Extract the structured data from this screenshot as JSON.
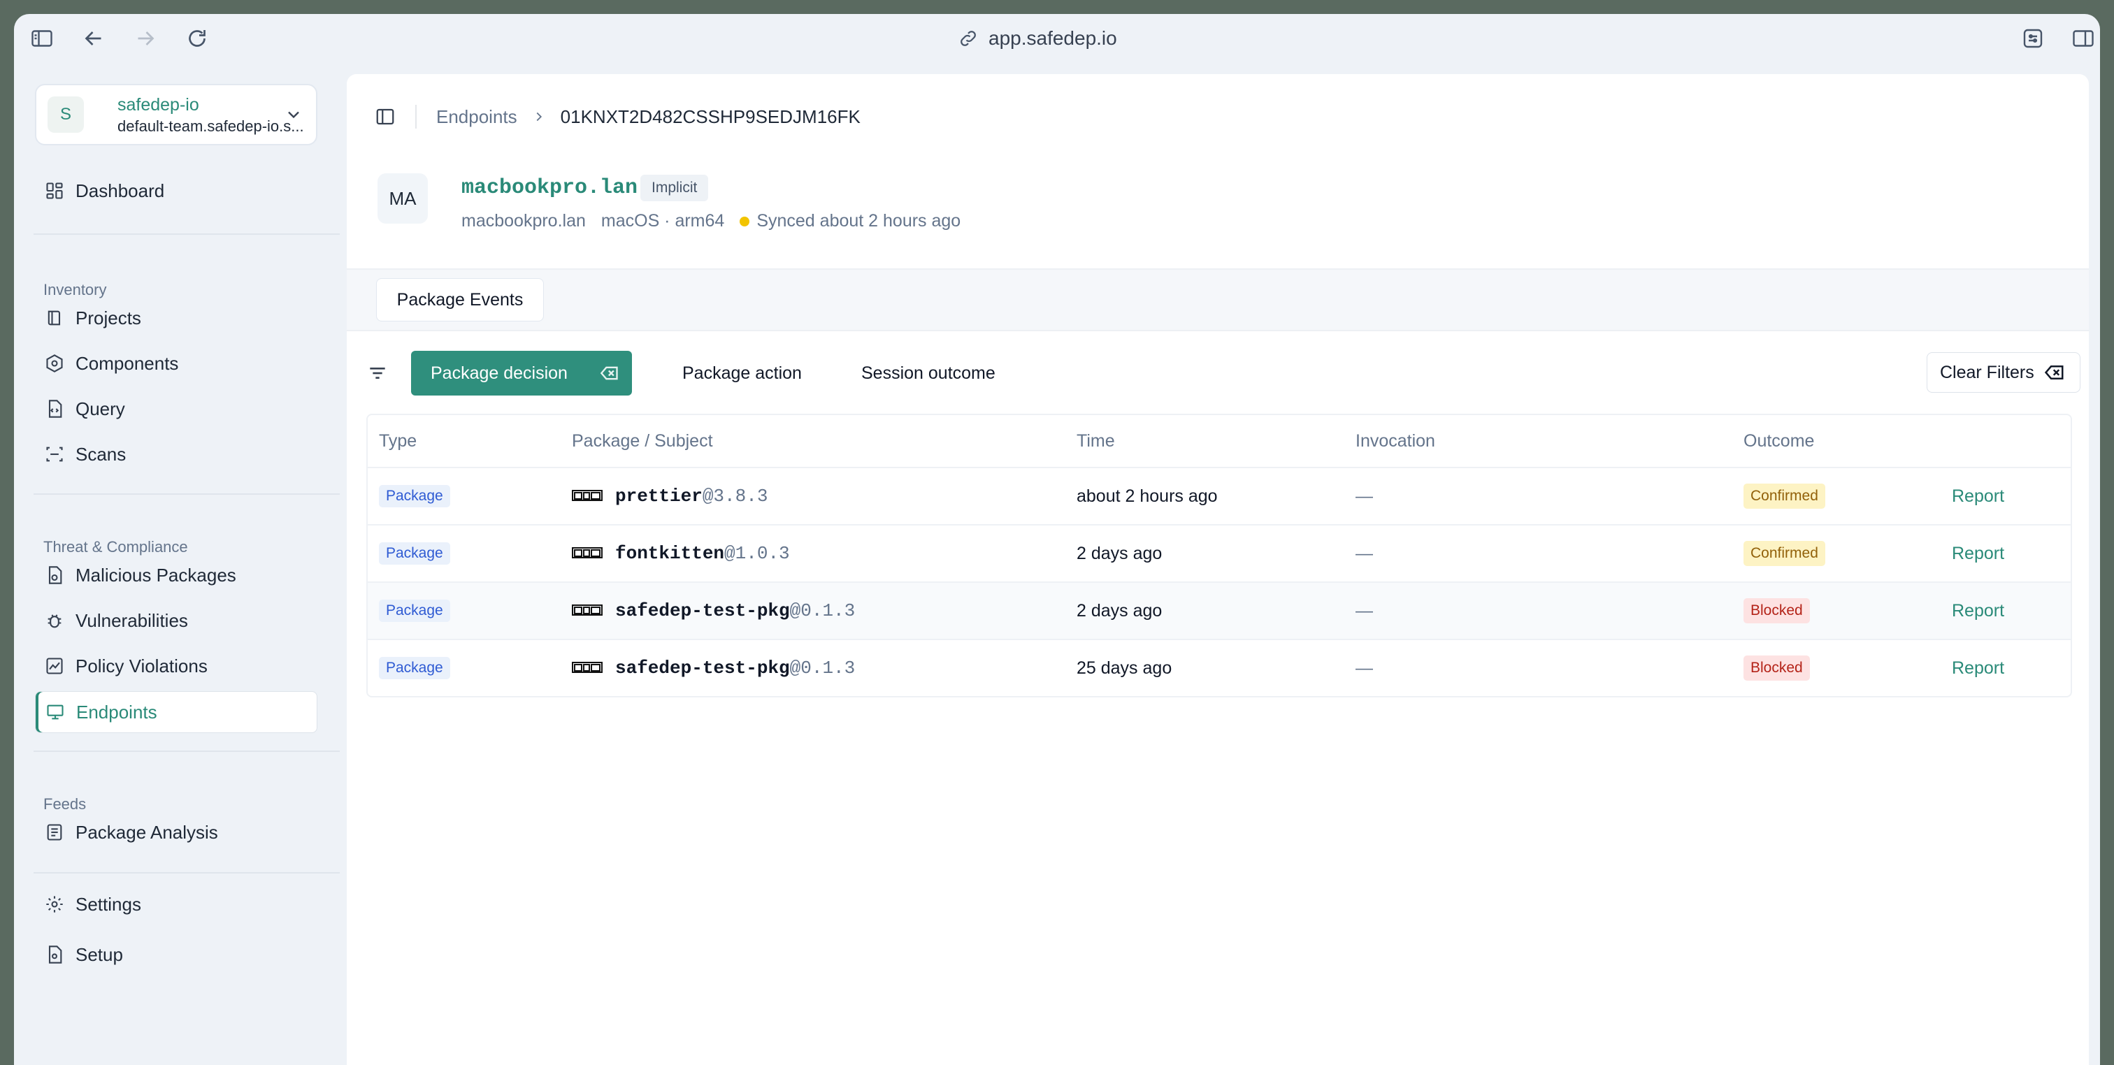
{
  "browser": {
    "url": "app.safedep.io"
  },
  "org": {
    "initial": "S",
    "name": "safedep-io",
    "team": "default-team.safedep-io.s..."
  },
  "sidebar": {
    "dashboard": "Dashboard",
    "inventory_label": "Inventory",
    "projects": "Projects",
    "components": "Components",
    "query": "Query",
    "scans": "Scans",
    "threat_label": "Threat & Compliance",
    "malicious": "Malicious Packages",
    "vulns": "Vulnerabilities",
    "policy": "Policy Violations",
    "endpoints": "Endpoints",
    "feeds_label": "Feeds",
    "package_analysis": "Package Analysis",
    "settings": "Settings",
    "setup": "Setup"
  },
  "breadcrumb": {
    "parent": "Endpoints",
    "current": "01KNXT2D482CSSHP9SEDJM16FK"
  },
  "endpoint": {
    "initials": "MA",
    "title": "macbookpro.lan",
    "badge": "Implicit",
    "hostname": "macbookpro.lan",
    "os": "macOS · arm64",
    "sync": "Synced about 2 hours ago",
    "sync_color": "#f2c400"
  },
  "tabs": {
    "active": "Package Events"
  },
  "filters": {
    "active_chip": "Package decision",
    "chip_action": "Package action",
    "chip_session": "Session outcome",
    "clear": "Clear Filters"
  },
  "table": {
    "headers": {
      "type": "Type",
      "package": "Package / Subject",
      "time": "Time",
      "invocation": "Invocation",
      "outcome": "Outcome"
    },
    "rows": [
      {
        "type": "Package",
        "name": "prettier",
        "version": "@3.8.3",
        "time": "about 2 hours ago",
        "invocation": "—",
        "outcome": "Confirmed",
        "action": "Report"
      },
      {
        "type": "Package",
        "name": "fontkitten",
        "version": "@1.0.3",
        "time": "2 days ago",
        "invocation": "—",
        "outcome": "Confirmed",
        "action": "Report"
      },
      {
        "type": "Package",
        "name": "safedep-test-pkg",
        "version": "@0.1.3",
        "time": "2 days ago",
        "invocation": "—",
        "outcome": "Blocked",
        "action": "Report"
      },
      {
        "type": "Package",
        "name": "safedep-test-pkg",
        "version": "@0.1.3",
        "time": "25 days ago",
        "invocation": "—",
        "outcome": "Blocked",
        "action": "Report"
      }
    ]
  },
  "colors": {
    "accent": "#2a8a78",
    "confirmed_bg": "#fdf3c4",
    "confirmed_fg": "#92610a",
    "blocked_bg": "#fde2e2",
    "blocked_fg": "#b42318"
  }
}
